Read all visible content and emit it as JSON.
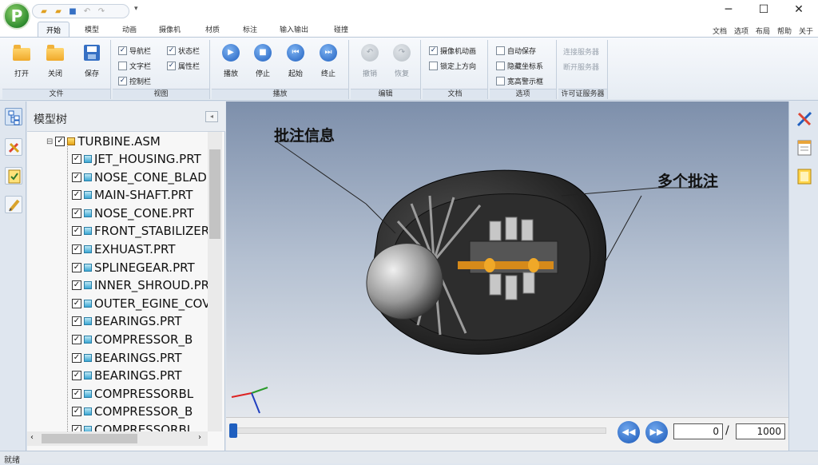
{
  "app": {
    "logo_letter": "P"
  },
  "quick_access": {
    "icons": [
      "open-folder-icon",
      "folder-icon",
      "save-icon",
      "undo-icon",
      "redo-icon"
    ],
    "more": "▾"
  },
  "window": {
    "minimize": "─",
    "maximize": "☐",
    "close": "✕"
  },
  "tabs": [
    "开始",
    "模型",
    "动画",
    "摄像机",
    "材质",
    "标注",
    "输入输出",
    "碰撞"
  ],
  "active_tab": "开始",
  "top_right": {
    "doc": "文档",
    "options": "选项",
    "layout": "布局",
    "help": "帮助",
    "about": "关于"
  },
  "ribbon": {
    "file": {
      "label": "文件",
      "open": "打开",
      "close": "关闭",
      "save": "保存"
    },
    "view": {
      "label": "视图",
      "nav_bar": "导航栏",
      "status_bar": "状态栏",
      "text_bar": "文字栏",
      "prop_bar": "属性栏",
      "control_bar": "控制栏"
    },
    "play": {
      "label": "播放",
      "play": "播放",
      "stop": "停止",
      "start": "起始",
      "end": "终止"
    },
    "edit": {
      "label": "编辑",
      "undo": "撤销",
      "redo": "恢复"
    },
    "doc": {
      "label": "文档",
      "camera_anim": "摄像机动画",
      "lock_up": "锁定上方向"
    },
    "options": {
      "label": "选项",
      "auto_save": "自动保存",
      "hide_axes": "隐藏坐标系",
      "wide_warn": "宽高警示框"
    },
    "license": {
      "label": "许可证服务器",
      "connect": "连接服务器",
      "disconnect": "断开服务器"
    }
  },
  "model_tree": {
    "title": "模型树",
    "root": "TURBINE.ASM",
    "items": [
      "JET_HOUSING.PRT",
      "NOSE_CONE_BLADE",
      "MAIN-SHAFT.PRT",
      "NOSE_CONE.PRT",
      "FRONT_STABILIZER",
      "EXHUAST.PRT",
      "SPLINEGEAR.PRT",
      "INNER_SHROUD.PRT",
      "OUTER_EGINE_COVER",
      "BEARINGS.PRT",
      "COMPRESSOR_B",
      "BEARINGS.PRT",
      "BEARINGS.PRT",
      "COMPRESSORBL",
      "COMPRESSOR_B",
      "COMPRESSORBL"
    ]
  },
  "viewport": {
    "annotation_1": "批注信息",
    "annotation_2": "多个批注"
  },
  "playbar": {
    "current_frame": "0",
    "separator": "/",
    "total_frames": "1000",
    "progress": 0
  },
  "status": {
    "text": "就绪"
  }
}
